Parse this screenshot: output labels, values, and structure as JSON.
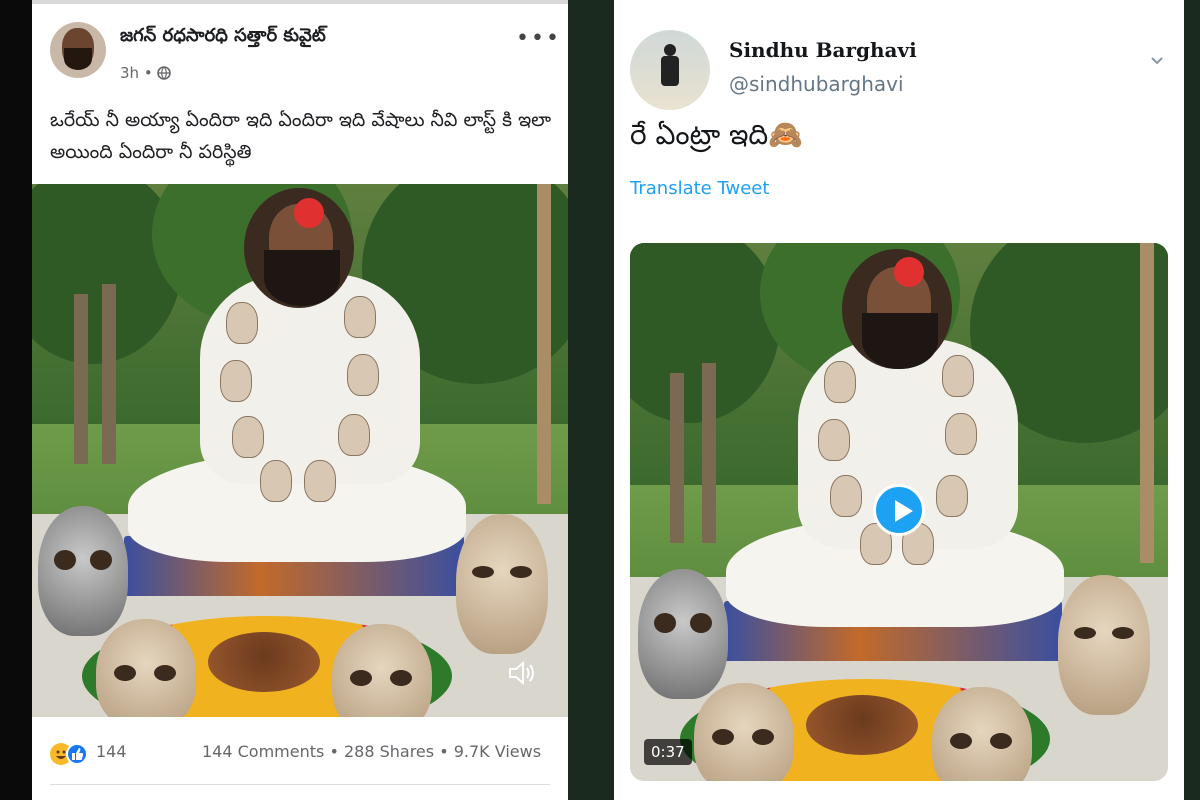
{
  "facebook_post": {
    "author": "జగన్ రధసారధి సత్తార్ కువైట్",
    "time": "3h",
    "separator": " • ",
    "privacy_icon": "globe-icon",
    "more_icon": "•••",
    "text": "ఒరేయ్ నీ అయ్యా ఏందిరా ఇది ఏందిరా ఇది వేషాలు నీవి లాస్ట్ కి ఇలా అయింది ఏందిరా నీ పరిస్థితి",
    "reactions_count": "144",
    "comments": "144 Comments",
    "shares": "288 Shares",
    "views": "9.7K Views",
    "stat_separator": " • ",
    "reaction_icons": [
      "haha-icon",
      "like-icon"
    ],
    "colors": {
      "like": "#1877f2",
      "haha": "#f7b928"
    }
  },
  "tweet": {
    "display_name": "Sindhu Barghavi",
    "handle": "@sindhubarghavi",
    "text": "రే ఏంట్రా ఇది",
    "emoji": "🙈",
    "translate_label": "Translate Tweet",
    "video_duration": "0:37",
    "colors": {
      "accent": "#1da1f2"
    }
  }
}
